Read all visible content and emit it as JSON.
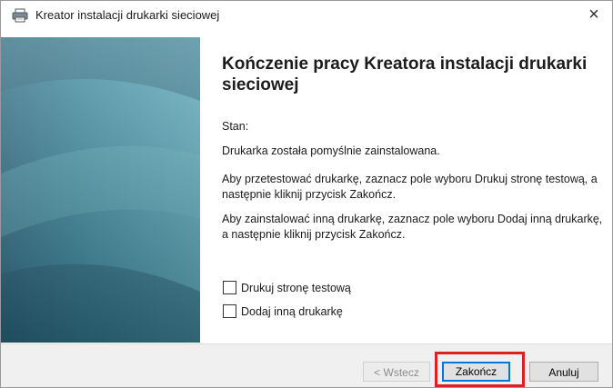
{
  "window": {
    "title": "Kreator instalacji drukarki sieciowej",
    "close_glyph": "×"
  },
  "icons": {
    "title_icon": "printer-icon",
    "close_icon": "close-icon"
  },
  "main": {
    "heading": "Kończenie pracy Kreatora instalacji drukarki sieciowej",
    "status_label": "Stan:",
    "status_text": "Drukarka została pomyślnie zainstalowana.",
    "test_instructions": "Aby przetestować drukarkę, zaznacz pole wyboru Drukuj stronę testową, a następnie kliknij przycisk Zakończ.",
    "add_instructions": "Aby zainstalować inną drukarkę, zaznacz pole wyboru Dodaj inną drukarkę, a następnie kliknij przycisk Zakończ."
  },
  "checkboxes": [
    {
      "label": "Drukuj stronę testową",
      "checked": false
    },
    {
      "label": "Dodaj inną drukarkę",
      "checked": false
    }
  ],
  "buttons": {
    "back": "< Wstecz",
    "finish": "Zakończ",
    "cancel": "Anuluj"
  },
  "colors": {
    "sidebar": "#3d8da3",
    "highlight": "#e02020",
    "default_button_border": "#0078d7"
  }
}
